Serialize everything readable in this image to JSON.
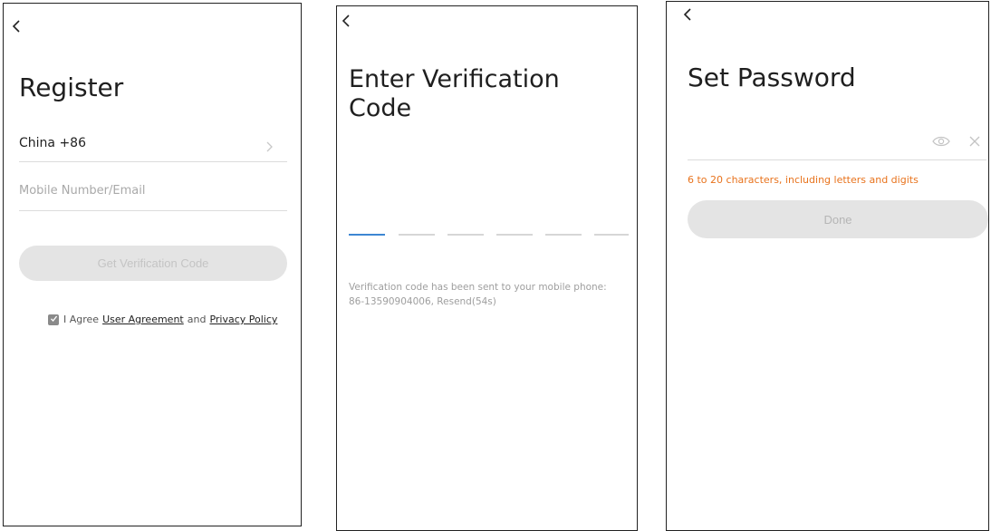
{
  "register": {
    "title": "Register",
    "country": "China +86",
    "account_placeholder": "Mobile Number/Email",
    "get_code_label": "Get Verification Code",
    "agree_prefix": "I Agree",
    "user_agreement": "User Agreement",
    "agree_and": "and",
    "privacy_policy": "Privacy Policy",
    "agree_checked": true
  },
  "verify": {
    "title_line1": "Enter Verification",
    "title_line2": "Code",
    "code_length": 6,
    "active_slot": 1,
    "sent_message_line1": "Verification code has been sent to your mobile phone:",
    "sent_message_line2": "86-13590904006, Resend(54s)"
  },
  "password": {
    "title": "Set Password",
    "requirement_hint": "6 to 20 characters, including letters and digits",
    "done_label": "Done",
    "hint_color": "#e8731d"
  },
  "icons": {
    "back": "back-arrow-icon",
    "chevron": "chevron-right-icon",
    "check": "checkmark-icon",
    "eye": "eye-icon",
    "clear": "close-icon"
  }
}
